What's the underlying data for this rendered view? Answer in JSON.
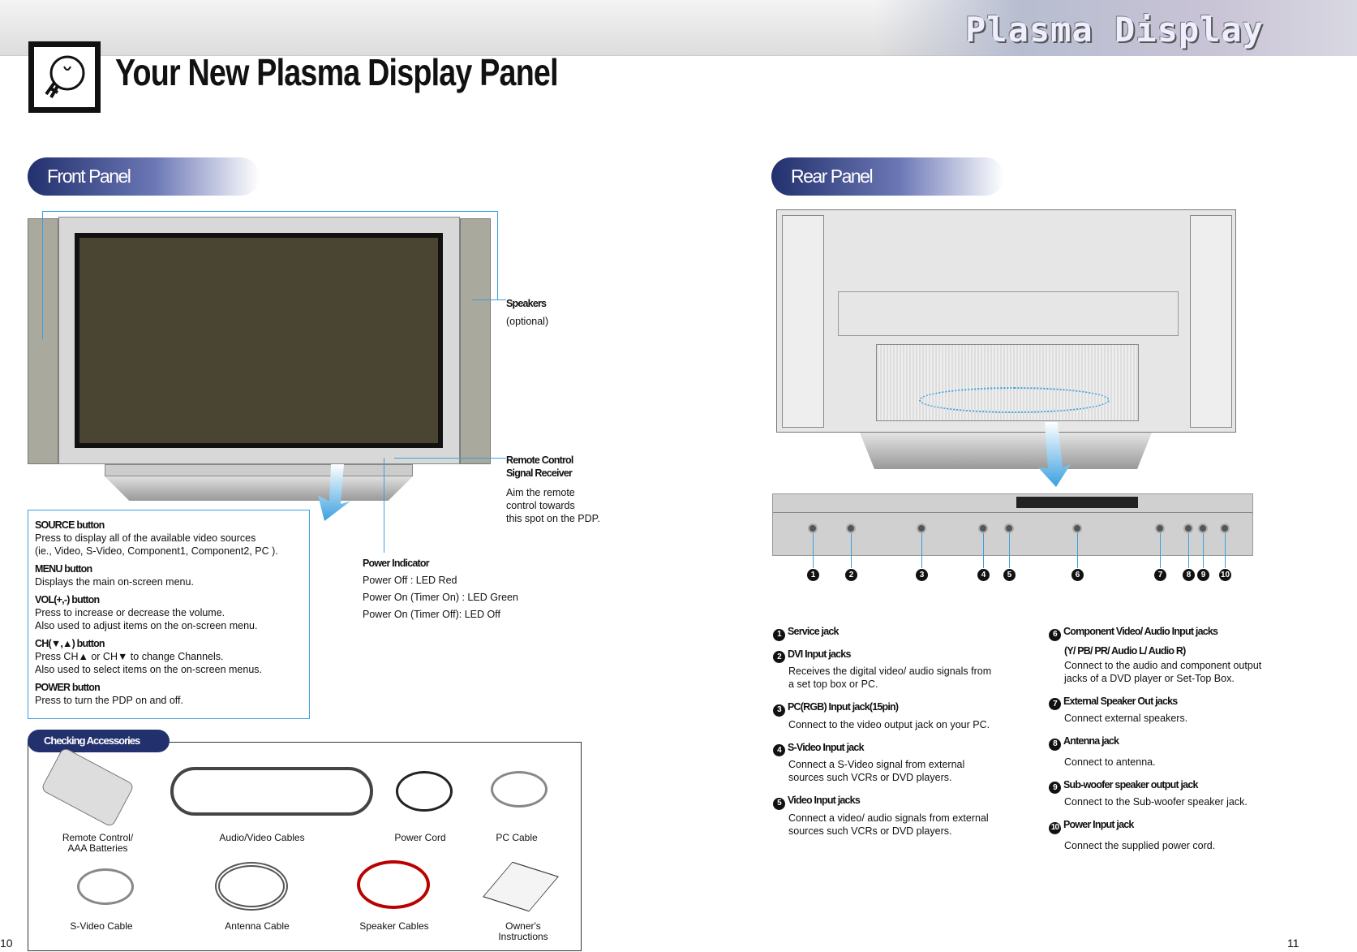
{
  "header": {
    "brand": "Plasma Display",
    "title": "Your New Plasma Display Panel",
    "icon": "lightbulb-icon"
  },
  "front": {
    "section": "Front Panel",
    "speakers": {
      "title": "Speakers",
      "sub": "(optional)"
    },
    "remote": {
      "title1": "Remote Control",
      "title2": "Signal Receiver",
      "l1": "Aim the remote",
      "l2": "control towards",
      "l3": "this spot on the PDP."
    },
    "buttons": [
      {
        "title": "SOURCE button",
        "l1": "Press to display all of the available video sources",
        "l2": "(ie., Video, S-Video, Component1, Component2, PC )."
      },
      {
        "title": "MENU button",
        "l1": "Displays the main on-screen menu.",
        "l2": ""
      },
      {
        "title": "VOL(+,-) button",
        "l1": "Press to increase or decrease the volume.",
        "l2": "Also used to adjust items on the on-screen menu."
      },
      {
        "title": "CH(▼,▲) button",
        "l1": "Press CH▲ or CH▼ to change Channels.",
        "l2": "Also used to select items on the on-screen menus."
      },
      {
        "title": "POWER button",
        "l1": "Press to turn the PDP on and off.",
        "l2": ""
      }
    ],
    "power": {
      "title": "Power Indicator",
      "l1": "Power Off  :  LED Red",
      "l2": "Power On (Timer On) : LED Green",
      "l3": "Power On (Timer Off):  LED Off"
    }
  },
  "accessories": {
    "title": "Checking Accessories",
    "items": [
      "Remote Control/",
      "AAA Batteries",
      "Audio/Video Cables",
      "Power Cord",
      "PC Cable",
      "S-Video Cable",
      "Antenna Cable",
      "Speaker Cables",
      "Owner's",
      "Instructions"
    ]
  },
  "rear": {
    "section": "Rear Panel",
    "numbers": [
      "1",
      "2",
      "3",
      "4",
      "5",
      "6",
      "7",
      "8",
      "9",
      "10"
    ],
    "left": [
      {
        "n": "1",
        "title": "Service jack",
        "l1": "",
        "l2": ""
      },
      {
        "n": "2",
        "title": "DVI Input jacks",
        "l1": "Receives the digital video/ audio signals from",
        "l2": "a set top box or PC."
      },
      {
        "n": "3",
        "title": "PC(RGB) Input jack(15pin)",
        "l1": "Connect to the video output jack on your PC.",
        "l2": ""
      },
      {
        "n": "4",
        "title": "S-Video Input jack",
        "l1": "Connect a S-Video signal from external",
        "l2": "sources such VCRs or DVD players."
      },
      {
        "n": "5",
        "title": "Video Input jacks",
        "l1": "Connect a video/ audio signals from external",
        "l2": "sources such VCRs or DVD players."
      }
    ],
    "right": [
      {
        "n": "6",
        "title": "Component Video/ Audio Input jacks",
        "title2": "(Y/ PB/ PR/ Audio L/ Audio R)",
        "l1": "Connect to the audio and component output",
        "l2": "jacks of a DVD player or Set-Top Box."
      },
      {
        "n": "7",
        "title": "External Speaker Out jacks",
        "title2": "",
        "l1": "Connect external speakers.",
        "l2": ""
      },
      {
        "n": "8",
        "title": "Antenna jack",
        "title2": "",
        "l1": "Connect to antenna.",
        "l2": ""
      },
      {
        "n": "9",
        "title": "Sub-woofer speaker output jack",
        "title2": "",
        "l1": "Connect to the Sub-woofer speaker jack.",
        "l2": ""
      },
      {
        "n": "10",
        "title": "Power Input jack",
        "title2": "",
        "l1": "Connect the supplied power cord.",
        "l2": ""
      }
    ]
  },
  "pages": {
    "left": "10",
    "right": "11"
  },
  "colors": {
    "accent": "#3aa0e0",
    "pill": "#23306e",
    "screen": "#4a4533"
  }
}
